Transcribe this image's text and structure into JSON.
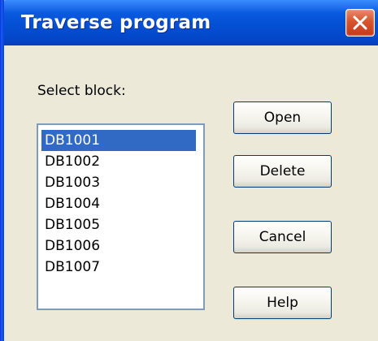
{
  "window": {
    "title": "Traverse program"
  },
  "dialog": {
    "select_label": "Select block:",
    "list_items": [
      "DB1001",
      "DB1002",
      "DB1003",
      "DB1004",
      "DB1005",
      "DB1006",
      "DB1007"
    ],
    "selected_index": 0
  },
  "buttons": {
    "open": "Open",
    "delete": "Delete",
    "cancel": "Cancel",
    "help": "Help"
  },
  "icons": {
    "close": "close-icon"
  },
  "colors": {
    "titlebar": "#0A5ADF",
    "dialog_background": "#ECE9D8",
    "selection": "#316AC5",
    "close_button": "#D6552E"
  }
}
